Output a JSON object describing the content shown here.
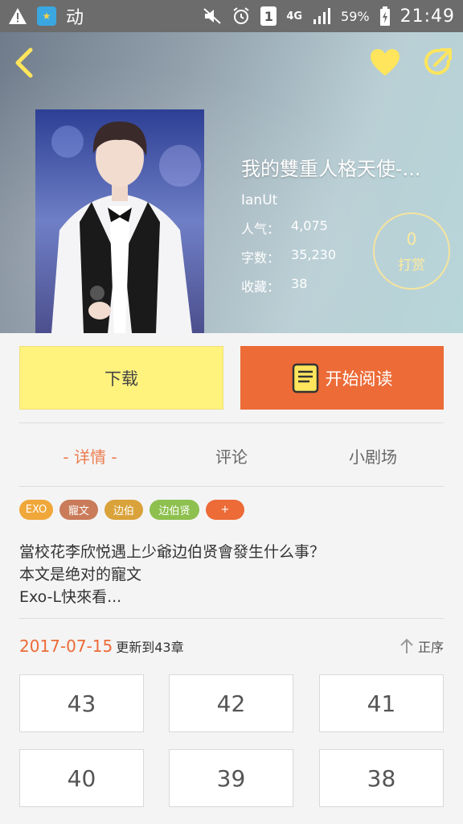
{
  "status_bar": {
    "app_label": "动",
    "sim_slot": "1",
    "network": "4G",
    "battery": "59%",
    "time": "21:49"
  },
  "book": {
    "title": "我的雙重人格天使-...",
    "author": "IanUt",
    "stats": [
      {
        "label": "人气：",
        "value": "4,075"
      },
      {
        "label": "字数：",
        "value": "35,230"
      },
      {
        "label": "收藏：",
        "value": "38"
      }
    ],
    "tip_count": "0",
    "tip_label": "打赏"
  },
  "actions": {
    "download_label": "下载",
    "read_label": "开始阅读"
  },
  "tabs": [
    {
      "label": "- 详情 -",
      "active": true
    },
    {
      "label": "评论",
      "active": false
    },
    {
      "label": "小剧场",
      "active": false
    }
  ],
  "tags": [
    {
      "label": "EXO",
      "color": "#f0a73a"
    },
    {
      "label": "寵文",
      "color": "#c97b5a"
    },
    {
      "label": "边伯",
      "color": "#d9a23a"
    },
    {
      "label": "边伯贤",
      "color": "#8dc04e"
    },
    {
      "label": "+",
      "color": "#ec6b37"
    }
  ],
  "description": [
    "當校花李欣悦遇上少爺边伯贤會發生什么事？",
    "本文是绝对的寵文",
    "Exo-L快來看..."
  ],
  "update": {
    "date": "2017-07-15",
    "text": "更新到43章",
    "sort_label": "正序"
  },
  "chapters": [
    "43",
    "42",
    "41",
    "40",
    "39",
    "38"
  ],
  "colors": {
    "accent": "#ec6b37",
    "download_bg": "#fff27d",
    "icon_yellow": "#ffe55c"
  }
}
